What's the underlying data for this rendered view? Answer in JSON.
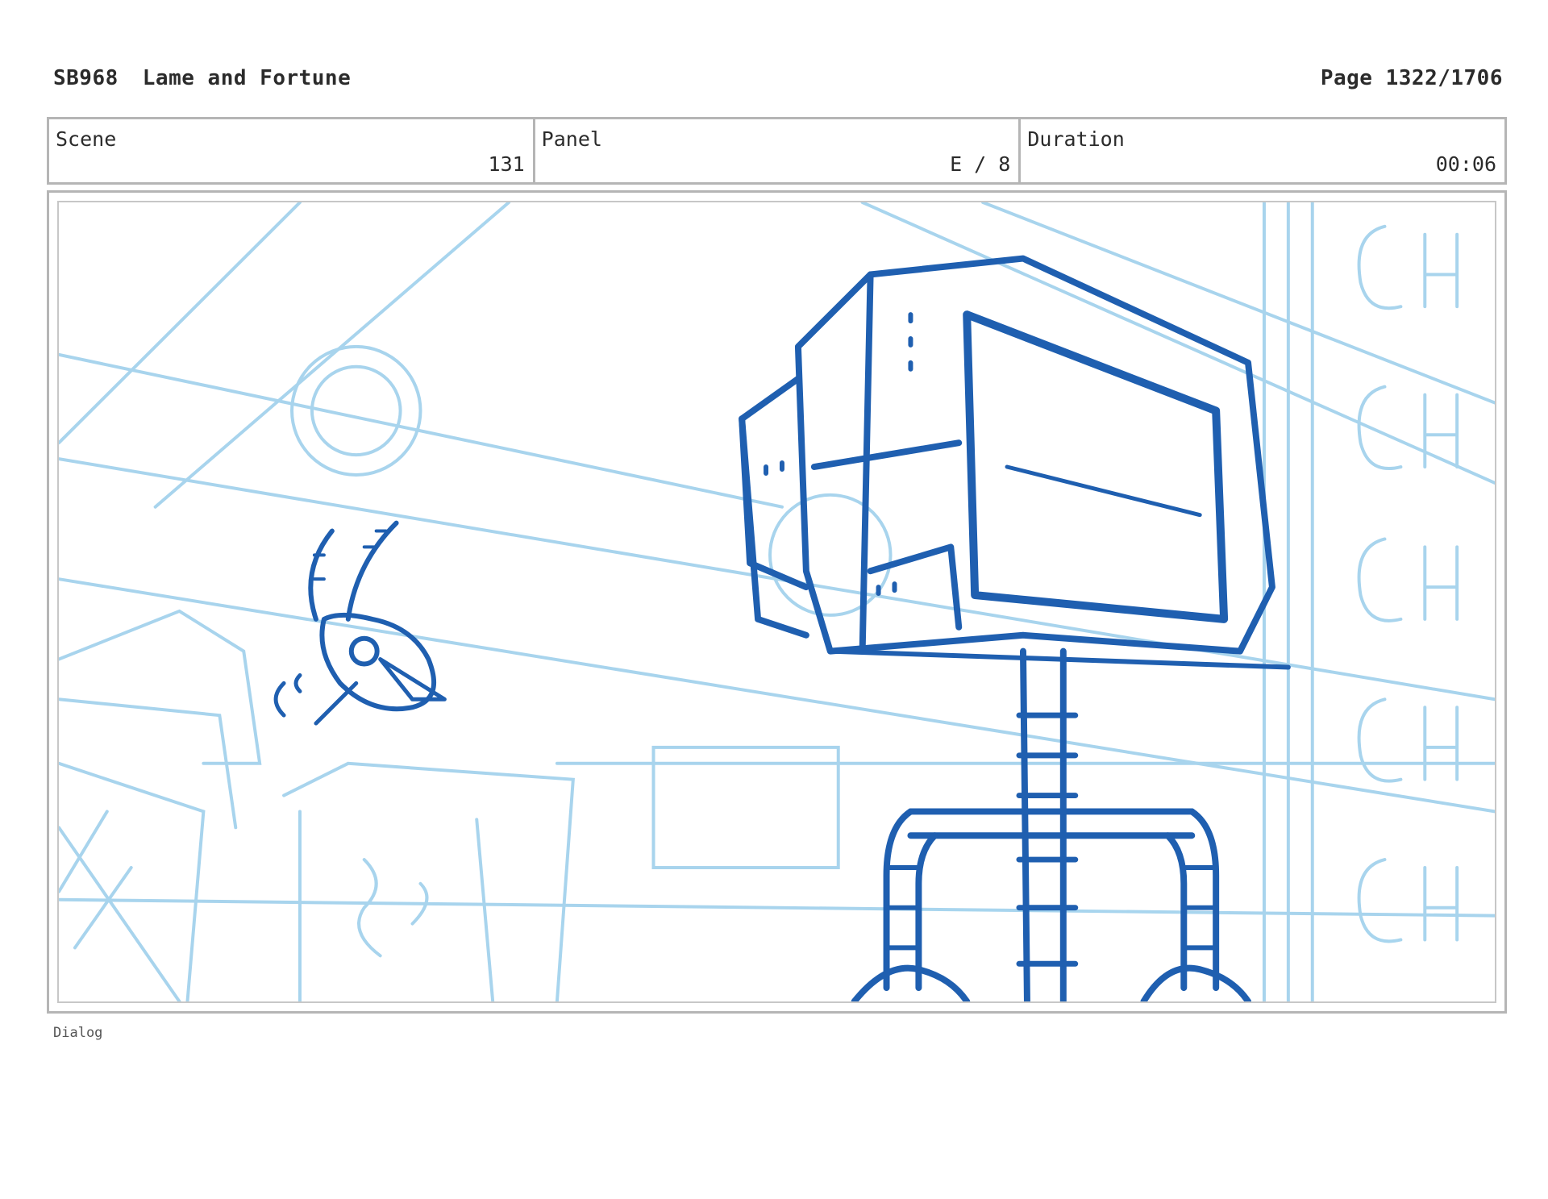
{
  "header": {
    "code": "SB968",
    "title": "Lame and Fortune",
    "page": "Page 1322/1706"
  },
  "info": {
    "scene_label": "Scene",
    "scene_value": "131",
    "panel_label": "Panel",
    "panel_value": "E / 8",
    "duration_label": "Duration",
    "duration_value": "00:06"
  },
  "dialog_label": "Dialog",
  "colors": {
    "frame_border": "#b5b5b5",
    "sketch_dark": "#1f5fb0",
    "sketch_light": "#9fd0ec"
  }
}
